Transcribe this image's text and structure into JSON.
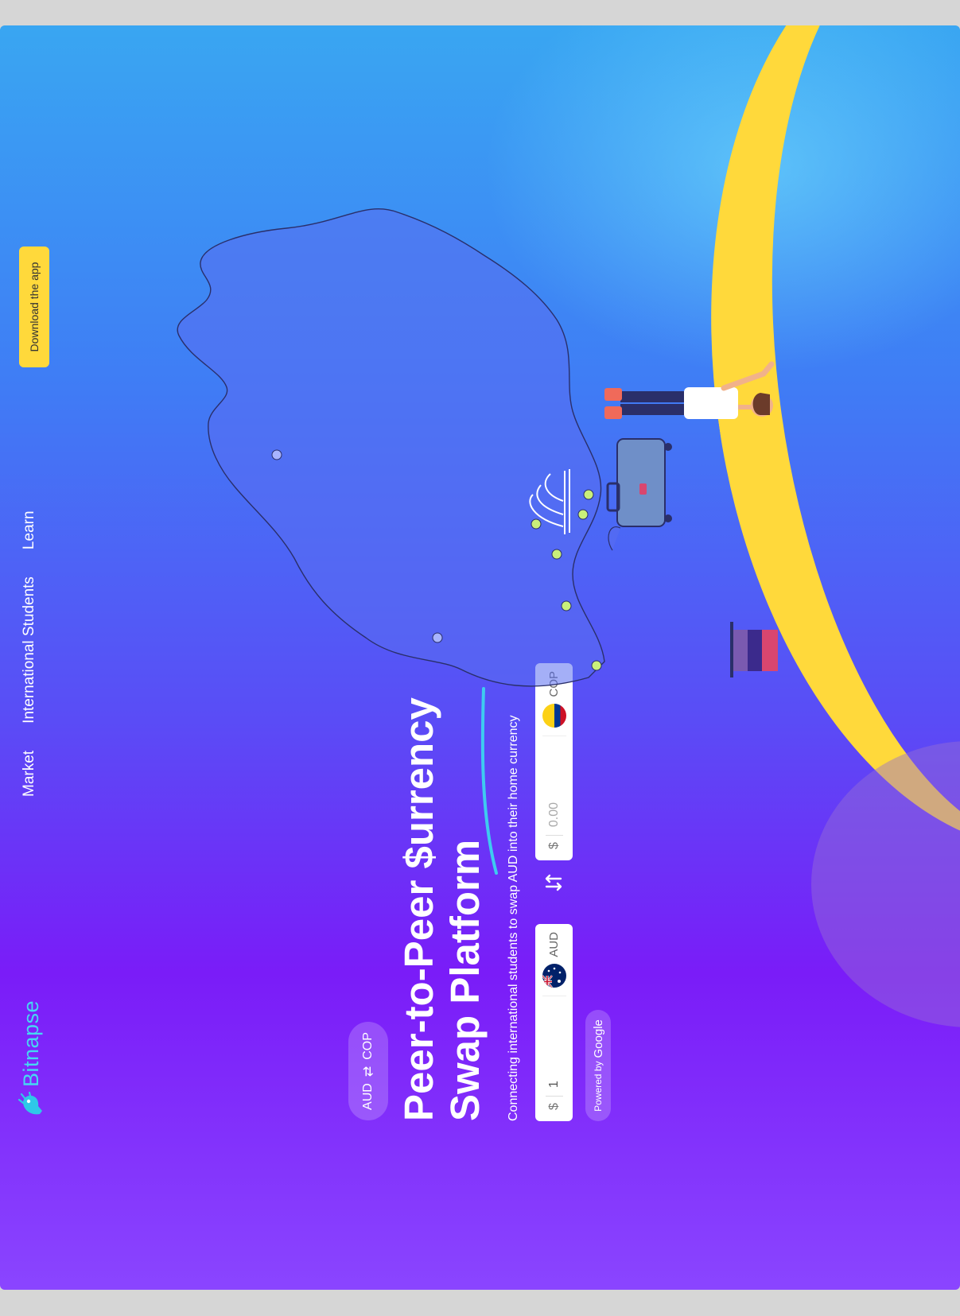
{
  "brand": {
    "name": "Bitnapse"
  },
  "nav": {
    "items": [
      {
        "label": "Market"
      },
      {
        "label": "International Students"
      },
      {
        "label": "Learn"
      }
    ],
    "download_label": "Download the app"
  },
  "hero": {
    "pair_chip": {
      "from": "AUD",
      "arrow": "⇄",
      "to": "COP"
    },
    "title_line1": "Peer-to-Peer $urrency",
    "title_line2": "Swap Platform",
    "subtitle": "Connecting international students to swap AUD into their home currency"
  },
  "converter": {
    "from": {
      "prefix": "$",
      "value": "1",
      "currency": "AUD"
    },
    "to": {
      "prefix": "$",
      "placeholder": "0.00",
      "currency": "COP"
    }
  },
  "powered": {
    "prefix": "Powered by",
    "brand": "Google"
  },
  "colors": {
    "accent_yellow": "#ffd93b",
    "brand_cyan": "#45d8f2",
    "purple": "#7a1cf8",
    "blue": "#3f7df5"
  }
}
